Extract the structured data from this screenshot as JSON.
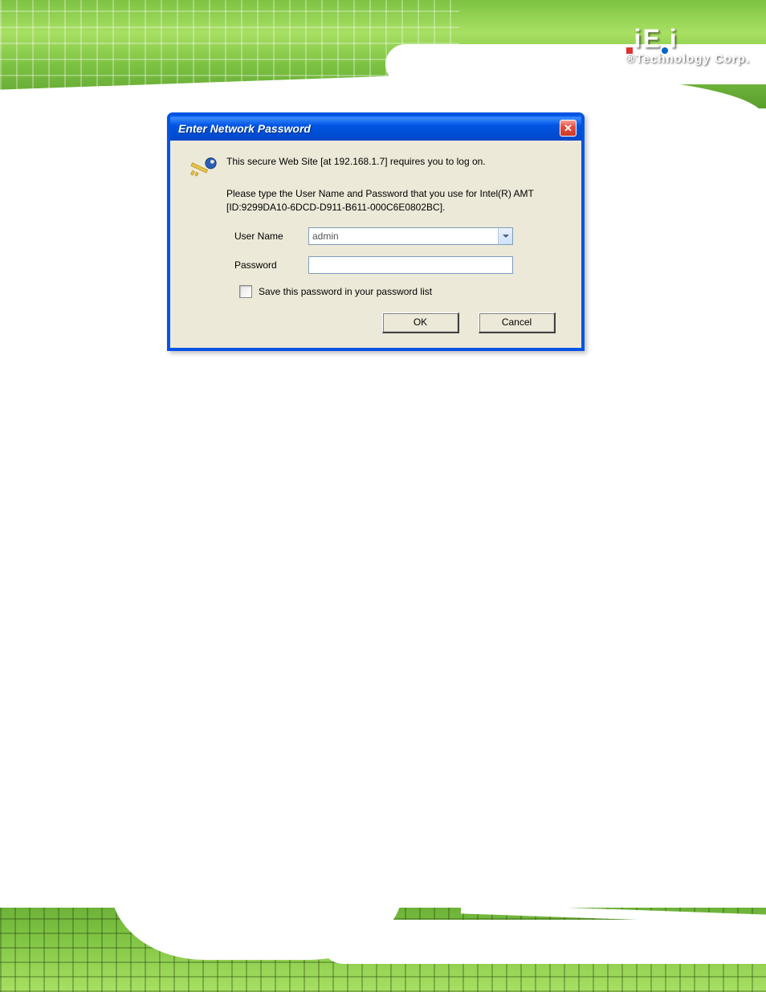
{
  "brand": {
    "name": "iEi",
    "tagline": "®Technology Corp."
  },
  "dialog": {
    "title": "Enter Network Password",
    "close": "✕",
    "message1": "This secure Web Site [at 192.168.1.7] requires you to log on.",
    "message2": "Please type the User Name and Password that you use for Intel(R) AMT [ID:9299DA10-6DCD-D911-B611-000C6E0802BC].",
    "username_label": "User Name",
    "username_value": "admin",
    "password_label": "Password",
    "password_value": "",
    "save_label": "Save this password in your password list",
    "ok": "OK",
    "cancel": "Cancel"
  }
}
